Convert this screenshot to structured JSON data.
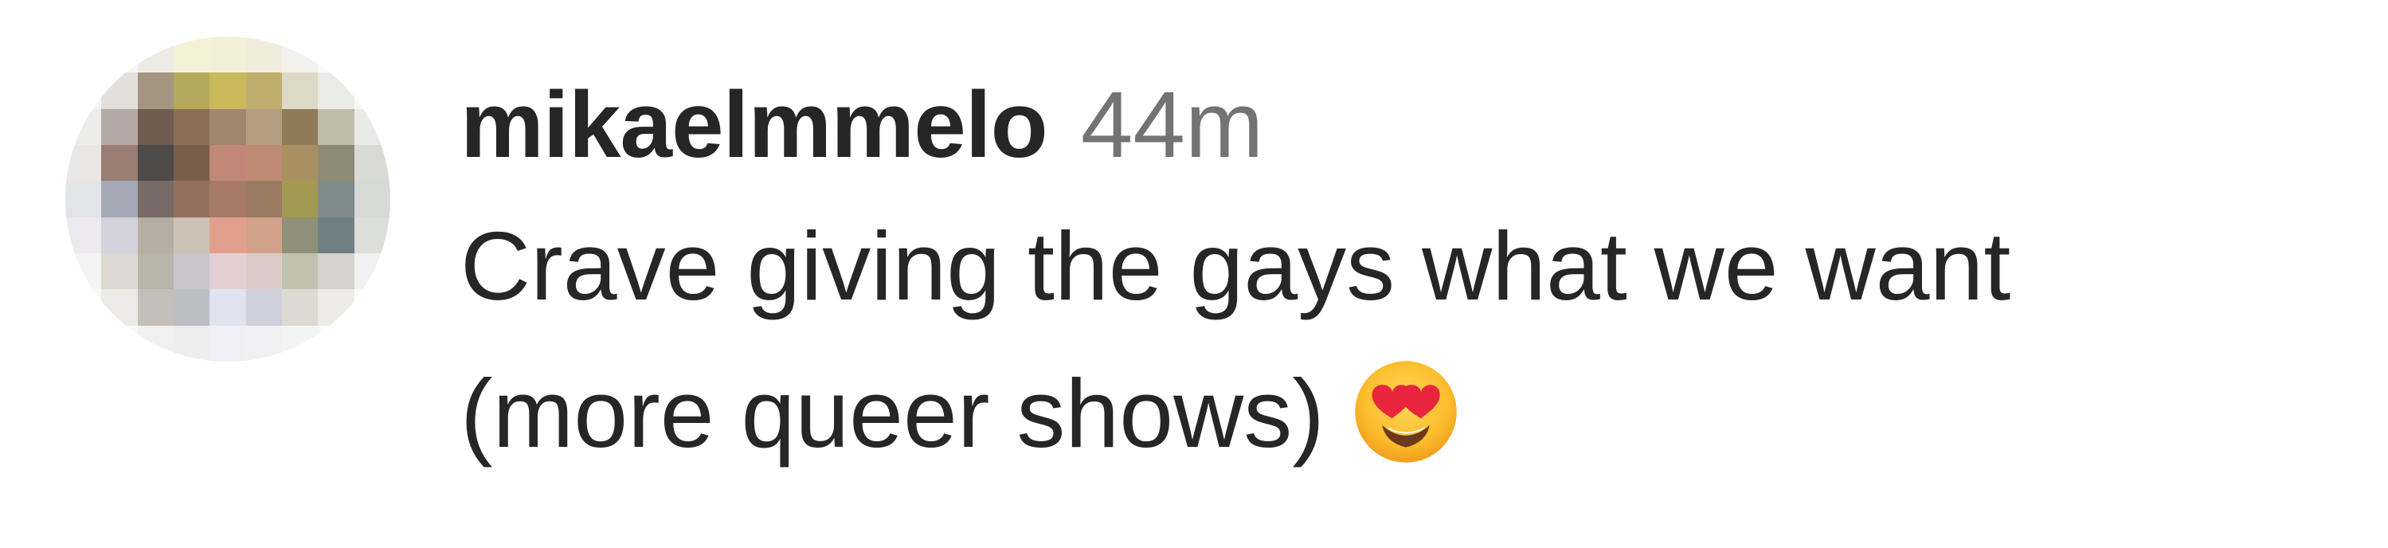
{
  "comment": {
    "username": "mikaelmmelo",
    "timestamp": "44m",
    "text_line_1": "Crave giving the gays what we want",
    "text_line_2": "(more queer shows)",
    "emoji": "smiling-face-with-heart-eyes"
  },
  "colors": {
    "username": "#262626",
    "timestamp": "#737373",
    "text": "#262626",
    "background": "#ffffff"
  }
}
